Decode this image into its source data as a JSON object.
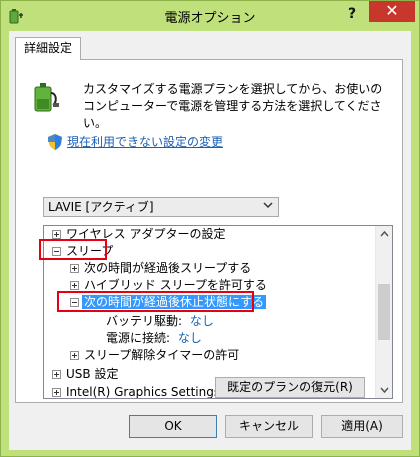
{
  "window": {
    "title": "電源オプション",
    "help_label": "?",
    "close_label": "✕"
  },
  "tab": {
    "label": "詳細設定"
  },
  "description": "カスタマイズする電源プランを選択してから、お使いのコンピューターで電源を管理する方法を選択してください。",
  "change_link": "現在利用できない設定の変更",
  "plan_select": {
    "value": "LAVIE [アクティブ]"
  },
  "tree": {
    "items": [
      {
        "label": "ワイヤレス アダプターの設定",
        "expander": "plus"
      },
      {
        "label": "スリープ",
        "expander": "minus"
      },
      {
        "label": "次の時間が経過後スリープする",
        "expander": "plus"
      },
      {
        "label": "ハイブリッド スリープを許可する",
        "expander": "plus"
      },
      {
        "label": "次の時間が経過後休止状態にする",
        "expander": "minus"
      },
      {
        "label": "バッテリ駆動:",
        "value": "なし"
      },
      {
        "label": "電源に接続:",
        "value": "なし"
      },
      {
        "label": "スリープ解除タイマーの許可",
        "expander": "plus"
      },
      {
        "label": "USB 設定",
        "expander": "plus"
      },
      {
        "label": "Intel(R) Graphics Settings",
        "expander": "plus"
      }
    ]
  },
  "buttons": {
    "restore": "既定のプランの復元(R)",
    "ok": "OK",
    "cancel": "キャンセル",
    "apply": "適用(A)"
  },
  "colors": {
    "titlebar": "#bfe07a",
    "close": "#c7372c",
    "selection": "#3399ff",
    "highlight_box": "#e60012",
    "link": "#1a5fb4"
  },
  "icons": {
    "app": "battery-plug-icon",
    "header": "battery-plug-icon",
    "link": "shield-icon"
  }
}
